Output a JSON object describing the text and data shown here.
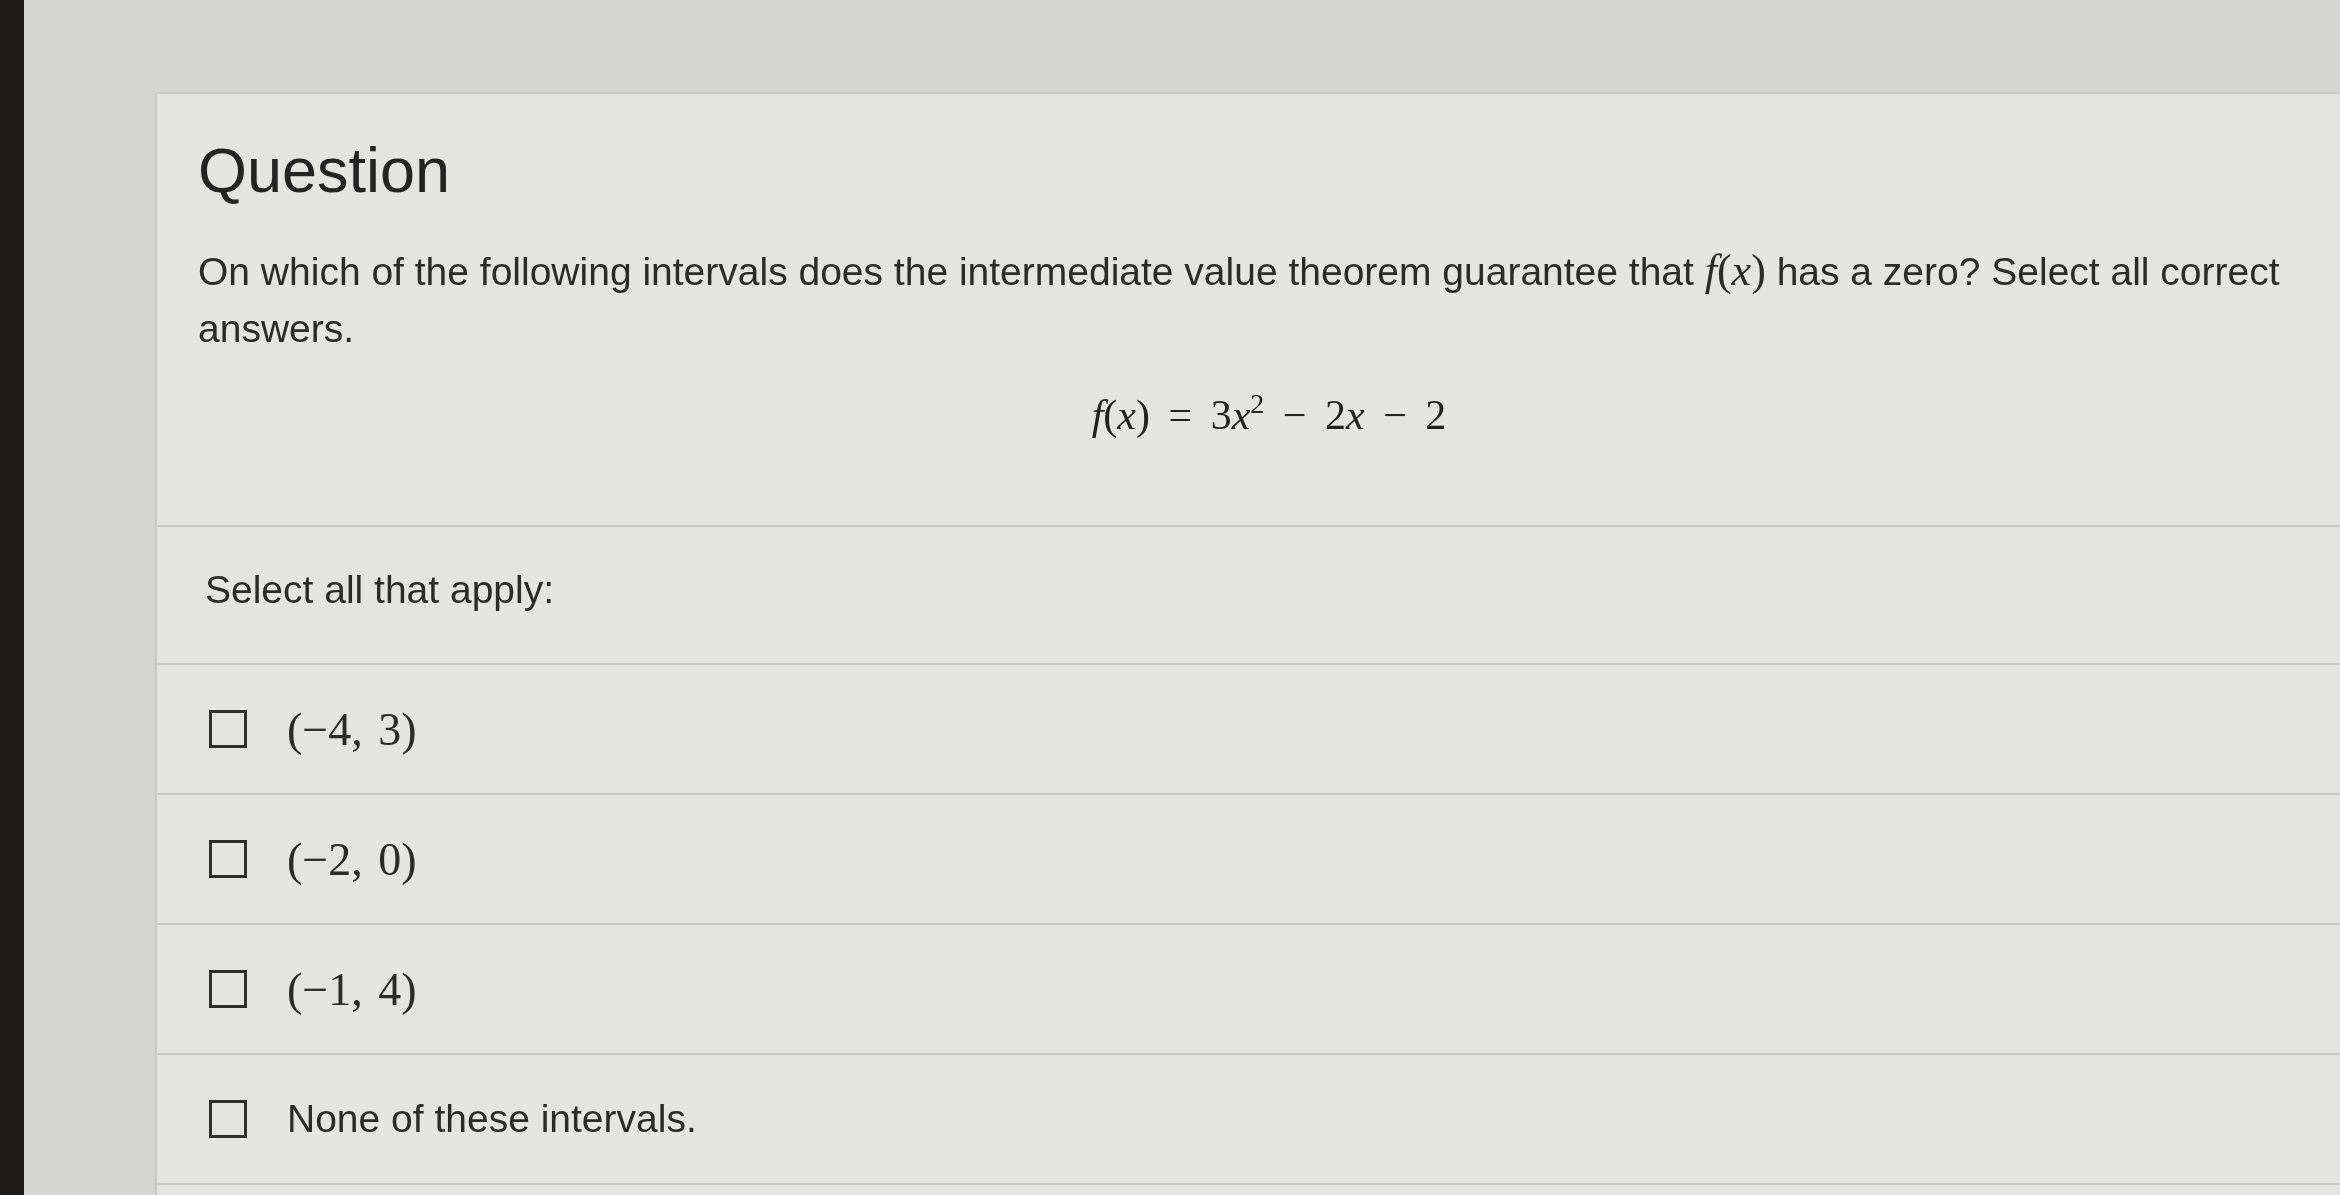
{
  "question": {
    "title": "Question",
    "prompt": [
      {
        "kind": "text",
        "text": "On which of the following intervals does the intermediate value theorem guarantee that "
      },
      {
        "kind": "math",
        "text": "*f*(*x*)"
      },
      {
        "kind": "text",
        "text": " has a zero? Select all correct answers."
      }
    ],
    "formula": [
      {
        "kind": "var",
        "text": "f"
      },
      {
        "kind": "sym",
        "text": "("
      },
      {
        "kind": "var",
        "text": "x"
      },
      {
        "kind": "sym",
        "text": ") = 3"
      },
      {
        "kind": "var",
        "text": "x"
      },
      {
        "kind": "sup",
        "text": "2"
      },
      {
        "kind": "sym",
        "text": " − 2"
      },
      {
        "kind": "var",
        "text": "x"
      },
      {
        "kind": "sym",
        "text": " − 2"
      }
    ]
  },
  "answers": {
    "instruction": "Select all that apply:",
    "options": [
      {
        "kind": "math",
        "label": "(−4, 3)",
        "checked": false
      },
      {
        "kind": "math",
        "label": "(−2, 0)",
        "checked": false
      },
      {
        "kind": "math",
        "label": "(−1, 4)",
        "checked": false
      },
      {
        "kind": "text",
        "label": "None of these intervals.",
        "checked": false
      }
    ]
  }
}
